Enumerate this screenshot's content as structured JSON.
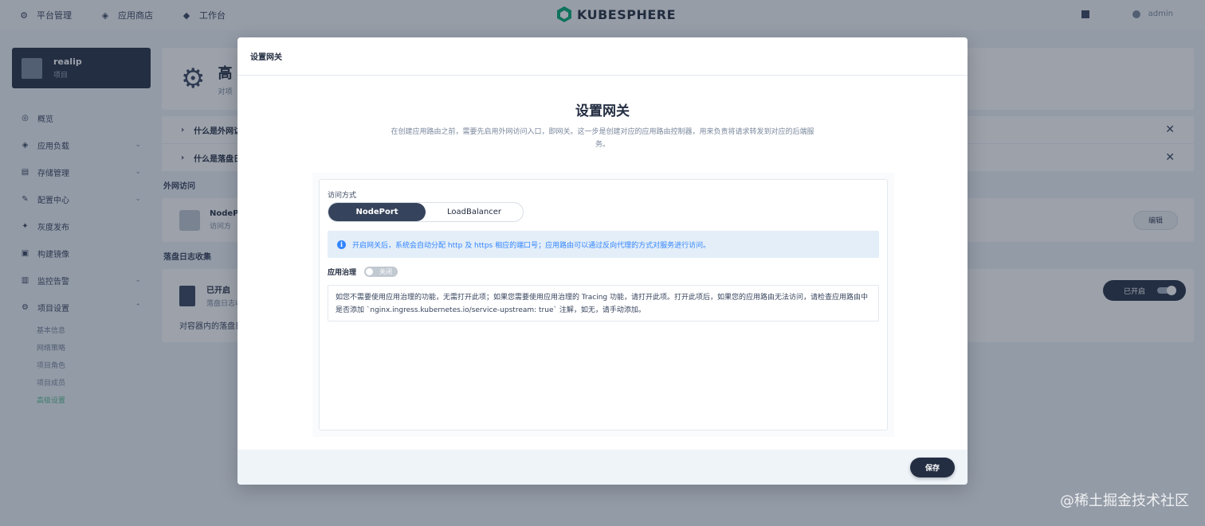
{
  "topbar": {
    "items": [
      {
        "label": "平台管理",
        "icon": "platform-icon"
      },
      {
        "label": "应用商店",
        "icon": "store-icon"
      },
      {
        "label": "工作台",
        "icon": "workbench-icon"
      }
    ],
    "logo": "KUBESPHERE",
    "user": "admin"
  },
  "sidebar": {
    "project_name": "realip",
    "project_type": "项目",
    "items": [
      {
        "label": "概览"
      },
      {
        "label": "应用负载"
      },
      {
        "label": "存储管理"
      },
      {
        "label": "配置中心"
      },
      {
        "label": "灰度发布"
      },
      {
        "label": "构建镜像"
      },
      {
        "label": "监控告警"
      },
      {
        "label": "项目设置"
      }
    ],
    "sub_items": [
      "基本信息",
      "网络策略",
      "项目角色",
      "项目成员",
      "高级设置"
    ]
  },
  "main": {
    "page_title": "高",
    "page_sub": "对项",
    "tips": [
      "什么是外网访",
      "什么是落盘日"
    ],
    "section_external": "外网访问",
    "nodeport_title": "NodePo",
    "nodeport_sub": "访问方",
    "edit_label": "编辑",
    "section_log": "落盘日志收集",
    "log_title": "已开启",
    "log_sub": "落盘日志收",
    "log_desc": "对容器内的落盘日",
    "log_on_label": "已开启"
  },
  "modal": {
    "header": "设置网关",
    "title": "设置网关",
    "desc": "在创建应用路由之前，需要先启用外网访问入口，即网关。这一步是创建对应的应用路由控制器，用来负责将请求转发到对应的后端服务。",
    "access_label": "访问方式",
    "options": [
      "NodePort",
      "LoadBalancer"
    ],
    "selected_option": "NodePort",
    "info_text": "开启网关后，系统会自动分配 http 及 https 相应的端口号；应用路由可以通过反向代理的方式对服务进行访问。",
    "gov_label": "应用治理",
    "toggle_label": "关闭",
    "gov_desc": "如您不需要使用应用治理的功能，无需打开此项；如果您需要使用应用治理的 Tracing 功能，请打开此项。打开此项后，如果您的应用路由无法访问，请检查应用路由中是否添加 `nginx.ingress.kubernetes.io/service-upstream: true` 注解，如无，请手动添加。",
    "save_label": "保存"
  },
  "watermark": "@稀土掘金技术社区",
  "colors": {
    "accent_dark": "#242e42",
    "info_blue": "#3385ff",
    "active_green": "#55bc8a"
  }
}
